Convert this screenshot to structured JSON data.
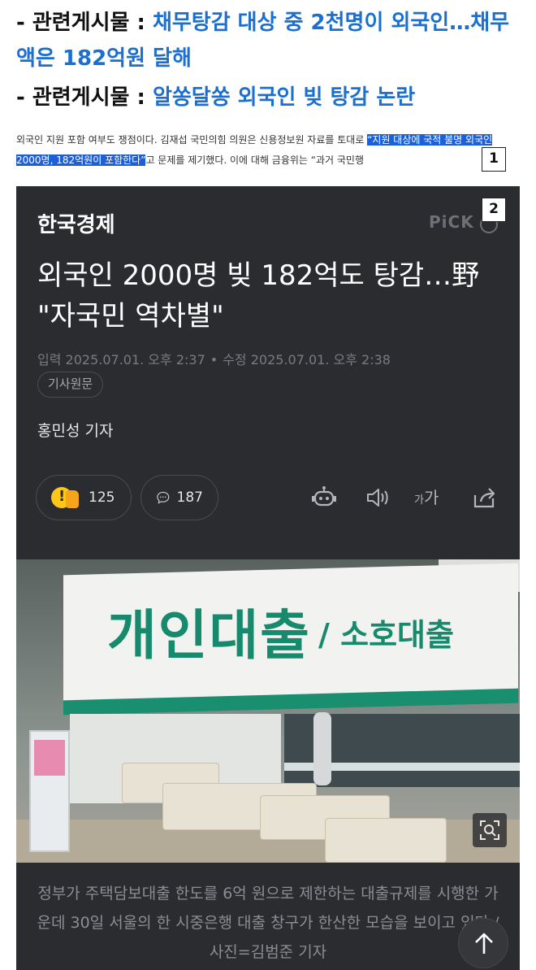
{
  "related": [
    {
      "label": "- 관련게시물 : ",
      "title": "채무탕감 대상 중 2천명이 외국인…채무액은 182억원 달해"
    },
    {
      "label": "- 관련게시물 : ",
      "title": "알쏭달쏭 외국인 빚 탕감 논란"
    }
  ],
  "snippet": {
    "pre": "외국인 지원 포함 여부도 쟁점이다. 김재섭 국민의힘 의원은 신용정보원 자료를 토대로 ",
    "highlight": "“지원 대상에 국적 불명 외국인 2000명, 182억원이 포함한다”",
    "post": "고 문제를 제기했다. 이에 대해 금융위는 “과거 국민행"
  },
  "badges": [
    "1",
    "2"
  ],
  "article": {
    "brand": "한국경제",
    "pick": "PiCK",
    "headline": "외국인 2000명 빚 182억도 탕감…野 \"자국민 역차별\"",
    "input_label": "입력 2025.07.01. 오후 2:37",
    "edit_label": "수정 2025.07.01. 오후 2:38",
    "dot": "•",
    "original_button": "기사원문",
    "reporter": "홍민성 기자",
    "reaction_count": "125",
    "comment_count": "187",
    "font_size_label_small": "가",
    "font_size_label_big": "가",
    "photo": {
      "sign_main": "개인대출",
      "sign_sub": "/ 소호대출"
    },
    "caption": "정부가 주택담보대출 한도를 6억 원으로 제한하는 대출규제를 시행한 가운데 30일 서울의 한 시중은행 대출 창구가 한산한 모습을 보이고 있다./사진=김범준 기자"
  },
  "colors": {
    "link": "#1a6fd0",
    "highlight": "#1c5fd6",
    "card_bg": "#2b2c30",
    "sign_green": "#178a6d"
  }
}
